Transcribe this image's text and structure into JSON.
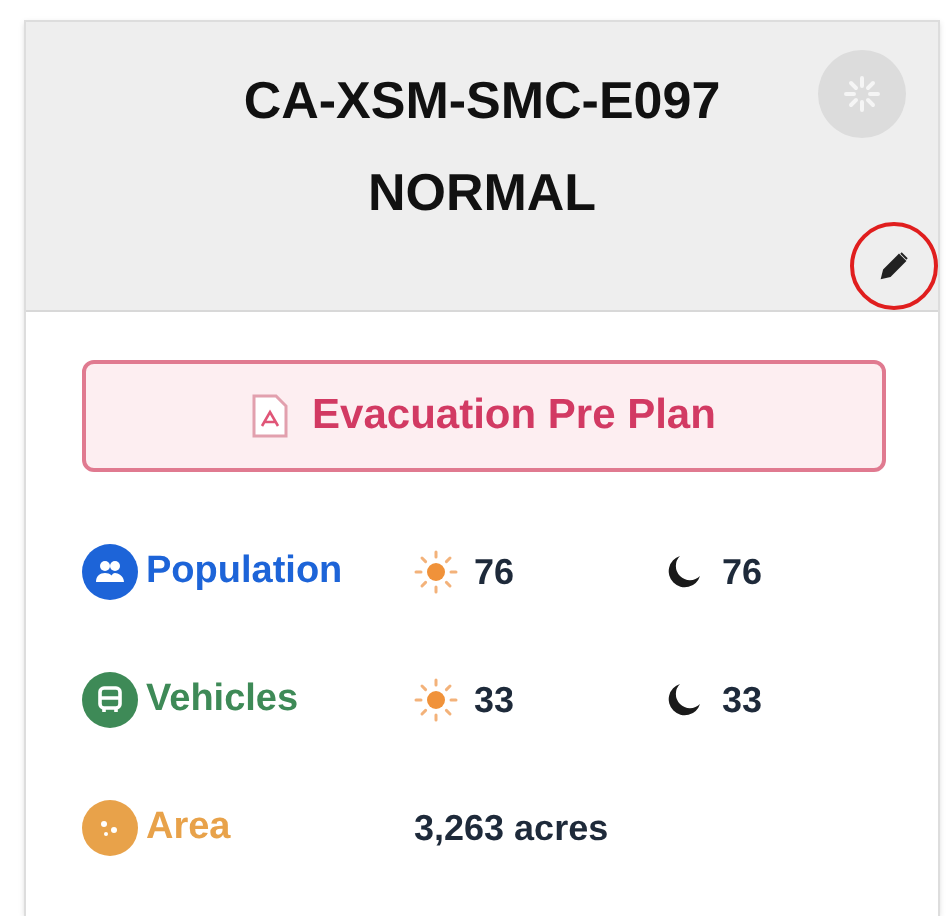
{
  "header": {
    "title": "CA-XSM-SMC-E097",
    "status": "NORMAL"
  },
  "plan_button": {
    "label": "Evacuation Pre Plan"
  },
  "stats": [
    {
      "kind": "split",
      "label": "Population",
      "color": "#1d64d8",
      "day": "76",
      "night": "76"
    },
    {
      "kind": "split",
      "label": "Vehicles",
      "color": "#3e8a57",
      "day": "33",
      "night": "33"
    },
    {
      "kind": "single",
      "label": "Area",
      "color": "#e8a24a",
      "value": "3,263 acres"
    }
  ]
}
